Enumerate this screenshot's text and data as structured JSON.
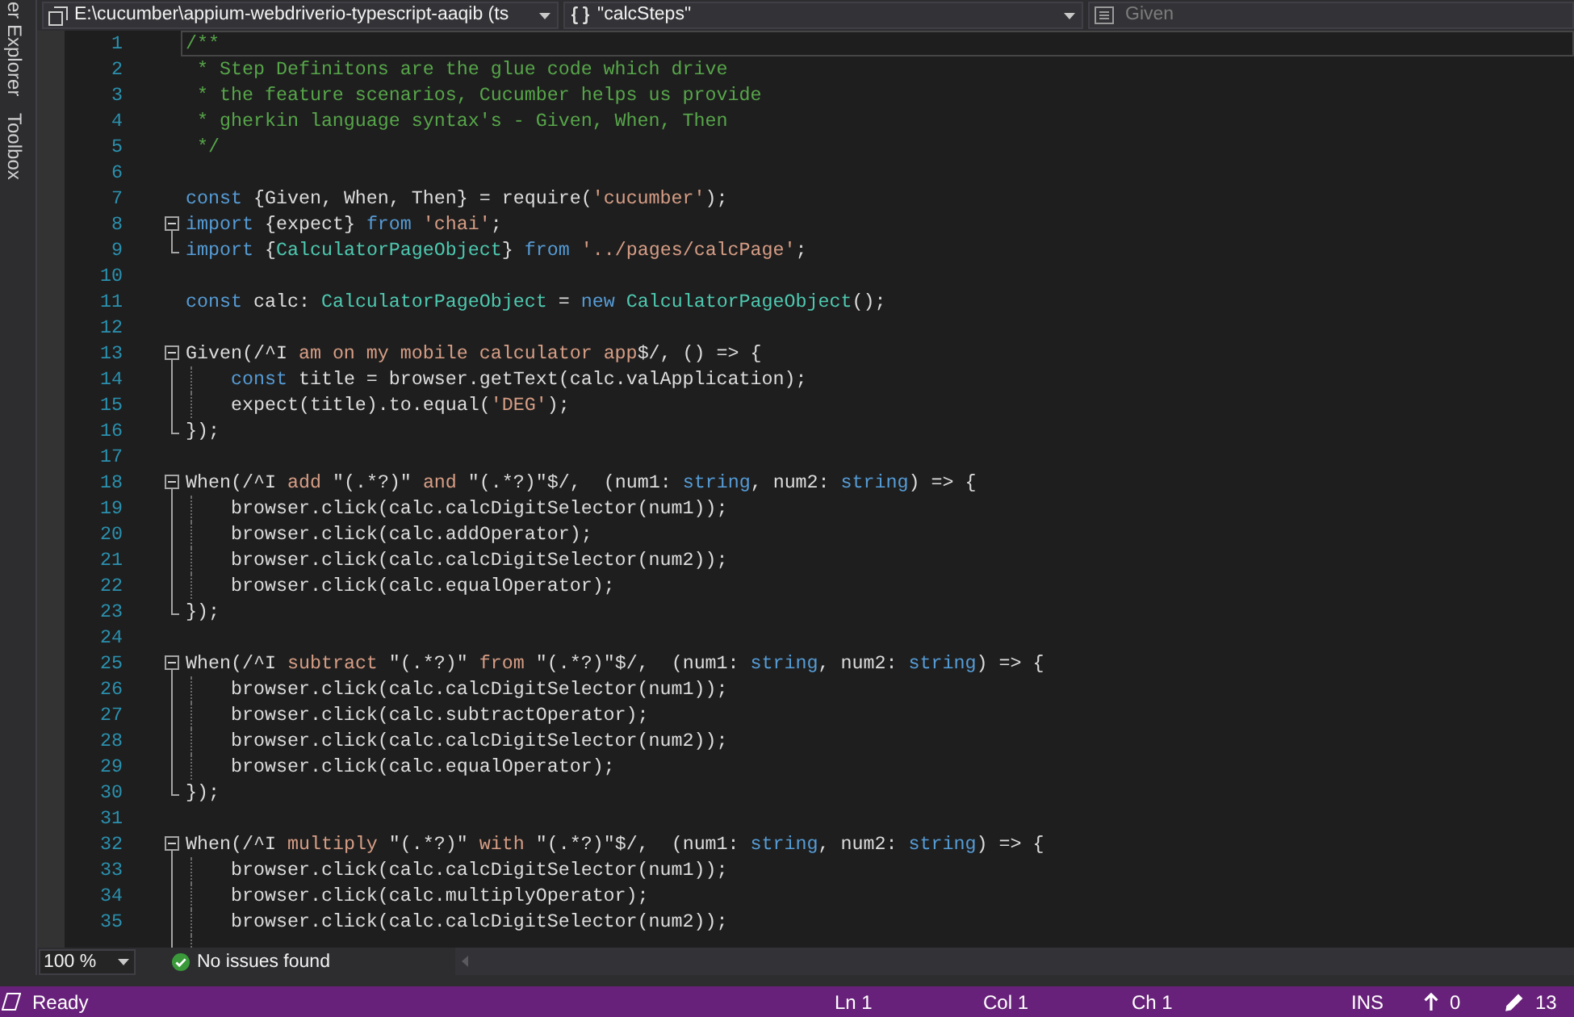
{
  "side_tabs": [
    {
      "label": "er Explorer"
    },
    {
      "label": "Toolbox"
    }
  ],
  "navigation_bar": {
    "project": "E:\\cucumber\\appium-webdriverio-typescript-aaqib (ts",
    "scope": "\"calcSteps\"",
    "member": {
      "label": "Given",
      "disabled": true
    }
  },
  "editor": {
    "lines": [
      {
        "number": "1",
        "kind": "plain",
        "current": true,
        "tokens": [
          {
            "kind": "comment",
            "text": "/**"
          }
        ]
      },
      {
        "number": "2",
        "kind": "plain",
        "current": false,
        "tokens": [
          {
            "kind": "comment",
            "text": " * Step Definitons are the glue code which drive"
          }
        ]
      },
      {
        "number": "3",
        "kind": "plain",
        "current": false,
        "tokens": [
          {
            "kind": "comment",
            "text": " * the feature scenarios, Cucumber helps us provide"
          }
        ]
      },
      {
        "number": "4",
        "kind": "plain",
        "current": false,
        "tokens": [
          {
            "kind": "comment",
            "text": " * gherkin language syntax's - Given, When, Then"
          }
        ]
      },
      {
        "number": "5",
        "kind": "plain",
        "current": false,
        "tokens": [
          {
            "kind": "comment",
            "text": " */"
          }
        ]
      },
      {
        "number": "6",
        "kind": "plain",
        "current": false
      },
      {
        "number": "7",
        "kind": "plain",
        "current": false,
        "tokens": [
          {
            "kind": "keyword",
            "text": "const"
          },
          {
            "kind": "plain",
            "text": " {Given, When, Then} = require("
          },
          {
            "kind": "string",
            "text": "'cucumber'"
          },
          {
            "kind": "plain",
            "text": ");"
          }
        ]
      },
      {
        "number": "8",
        "kind": "opener",
        "current": false,
        "tokens": [
          {
            "kind": "keyword",
            "text": "import"
          },
          {
            "kind": "plain",
            "text": " {expect} "
          },
          {
            "kind": "keyword",
            "text": "from"
          },
          {
            "kind": "string",
            "text": " 'chai'"
          },
          {
            "kind": "plain",
            "text": ";"
          }
        ]
      },
      {
        "number": "9",
        "kind": "closer",
        "current": false,
        "tokens": [
          {
            "kind": "keyword",
            "text": "import"
          },
          {
            "kind": "plain",
            "text": " {"
          },
          {
            "kind": "type",
            "text": "CalculatorPageObject"
          },
          {
            "kind": "plain",
            "text": "} "
          },
          {
            "kind": "keyword",
            "text": "from"
          },
          {
            "kind": "string",
            "text": " '../pages/calcPage'"
          },
          {
            "kind": "plain",
            "text": ";"
          }
        ]
      },
      {
        "number": "10",
        "kind": "plain",
        "current": false
      },
      {
        "number": "11",
        "kind": "plain",
        "current": false,
        "tokens": [
          {
            "kind": "keyword",
            "text": "const"
          },
          {
            "kind": "plain",
            "text": " calc: "
          },
          {
            "kind": "type",
            "text": "CalculatorPageObject"
          },
          {
            "kind": "plain",
            "text": " = "
          },
          {
            "kind": "keyword",
            "text": "new"
          },
          {
            "kind": "type",
            "text": " CalculatorPageObject"
          },
          {
            "kind": "plain",
            "text": "();"
          }
        ]
      },
      {
        "number": "12",
        "kind": "plain",
        "current": false
      },
      {
        "number": "13",
        "kind": "opener",
        "current": false,
        "tokens": [
          {
            "kind": "plain",
            "text": "Given(/^I "
          },
          {
            "kind": "string",
            "text": "am on my mobile calculator app"
          },
          {
            "kind": "plain",
            "text": "$/, () => {"
          }
        ]
      },
      {
        "number": "14",
        "kind": "inner",
        "current": false,
        "tokens": [
          {
            "kind": "keyword",
            "text": "    const"
          },
          {
            "kind": "plain",
            "text": " title = browser.getText(calc.valApplication);"
          }
        ]
      },
      {
        "number": "15",
        "kind": "inner",
        "current": false,
        "tokens": [
          {
            "kind": "plain",
            "text": "    expect(title).to.equal("
          },
          {
            "kind": "string",
            "text": "'DEG'"
          },
          {
            "kind": "plain",
            "text": ");"
          }
        ]
      },
      {
        "number": "16",
        "kind": "closer",
        "current": false,
        "tokens": [
          {
            "kind": "plain",
            "text": "});"
          }
        ]
      },
      {
        "number": "17",
        "kind": "plain",
        "current": false
      },
      {
        "number": "18",
        "kind": "opener",
        "current": false,
        "tokens": [
          {
            "kind": "plain",
            "text": "When(/^I "
          },
          {
            "kind": "string",
            "text": "add"
          },
          {
            "kind": "plain",
            "text": " \"(.*?)\" "
          },
          {
            "kind": "string",
            "text": "and"
          },
          {
            "kind": "plain",
            "text": " \"(.*?)\"$/,  (num1: "
          },
          {
            "kind": "keyword",
            "text": "string"
          },
          {
            "kind": "plain",
            "text": ", num2: "
          },
          {
            "kind": "keyword",
            "text": "string"
          },
          {
            "kind": "plain",
            "text": ") => {"
          }
        ]
      },
      {
        "number": "19",
        "kind": "inner",
        "current": false,
        "tokens": [
          {
            "kind": "plain",
            "text": "    browser.click(calc.calcDigitSelector(num1));"
          }
        ]
      },
      {
        "number": "20",
        "kind": "inner",
        "current": false,
        "tokens": [
          {
            "kind": "plain",
            "text": "    browser.click(calc.addOperator);"
          }
        ]
      },
      {
        "number": "21",
        "kind": "inner",
        "current": false,
        "tokens": [
          {
            "kind": "plain",
            "text": "    browser.click(calc.calcDigitSelector(num2));"
          }
        ]
      },
      {
        "number": "22",
        "kind": "inner",
        "current": false,
        "tokens": [
          {
            "kind": "plain",
            "text": "    browser.click(calc.equalOperator);"
          }
        ]
      },
      {
        "number": "23",
        "kind": "closer",
        "current": false,
        "tokens": [
          {
            "kind": "plain",
            "text": "});"
          }
        ]
      },
      {
        "number": "24",
        "kind": "plain",
        "current": false
      },
      {
        "number": "25",
        "kind": "opener",
        "current": false,
        "tokens": [
          {
            "kind": "plain",
            "text": "When(/^I "
          },
          {
            "kind": "string",
            "text": "subtract"
          },
          {
            "kind": "plain",
            "text": " \"(.*?)\" "
          },
          {
            "kind": "string",
            "text": "from"
          },
          {
            "kind": "plain",
            "text": " \"(.*?)\"$/,  (num1: "
          },
          {
            "kind": "keyword",
            "text": "string"
          },
          {
            "kind": "plain",
            "text": ", num2: "
          },
          {
            "kind": "keyword",
            "text": "string"
          },
          {
            "kind": "plain",
            "text": ") => {"
          }
        ]
      },
      {
        "number": "26",
        "kind": "inner",
        "current": false,
        "tokens": [
          {
            "kind": "plain",
            "text": "    browser.click(calc.calcDigitSelector(num1));"
          }
        ]
      },
      {
        "number": "27",
        "kind": "inner",
        "current": false,
        "tokens": [
          {
            "kind": "plain",
            "text": "    browser.click(calc.subtractOperator);"
          }
        ]
      },
      {
        "number": "28",
        "kind": "inner",
        "current": false,
        "tokens": [
          {
            "kind": "plain",
            "text": "    browser.click(calc.calcDigitSelector(num2));"
          }
        ]
      },
      {
        "number": "29",
        "kind": "inner",
        "current": false,
        "tokens": [
          {
            "kind": "plain",
            "text": "    browser.click(calc.equalOperator);"
          }
        ]
      },
      {
        "number": "30",
        "kind": "closer",
        "current": false,
        "tokens": [
          {
            "kind": "plain",
            "text": "});"
          }
        ]
      },
      {
        "number": "31",
        "kind": "plain",
        "current": false
      },
      {
        "number": "32",
        "kind": "opener",
        "current": false,
        "tokens": [
          {
            "kind": "plain",
            "text": "When(/^I "
          },
          {
            "kind": "string",
            "text": "multiply"
          },
          {
            "kind": "plain",
            "text": " \"(.*?)\" "
          },
          {
            "kind": "string",
            "text": "with"
          },
          {
            "kind": "plain",
            "text": " \"(.*?)\"$/,  (num1: "
          },
          {
            "kind": "keyword",
            "text": "string"
          },
          {
            "kind": "plain",
            "text": ", num2: "
          },
          {
            "kind": "keyword",
            "text": "string"
          },
          {
            "kind": "plain",
            "text": ") => {"
          }
        ]
      },
      {
        "number": "33",
        "kind": "inner",
        "current": false,
        "tokens": [
          {
            "kind": "plain",
            "text": "    browser.click(calc.calcDigitSelector(num1));"
          }
        ]
      },
      {
        "number": "34",
        "kind": "inner",
        "current": false,
        "tokens": [
          {
            "kind": "plain",
            "text": "    browser.click(calc.multiplyOperator);"
          }
        ]
      },
      {
        "number": "35",
        "kind": "inner",
        "current": false,
        "tokens": [
          {
            "kind": "plain",
            "text": "    browser.click(calc.calcDigitSelector(num2));"
          }
        ]
      }
    ]
  },
  "editor_footer": {
    "zoom": "100 %",
    "issues": "No issues found"
  },
  "status_bar": {
    "message": "Ready",
    "line": "Ln 1",
    "column": "Col 1",
    "char": "Ch 1",
    "mode": "INS",
    "pending_changes": "0",
    "edits": "13"
  }
}
